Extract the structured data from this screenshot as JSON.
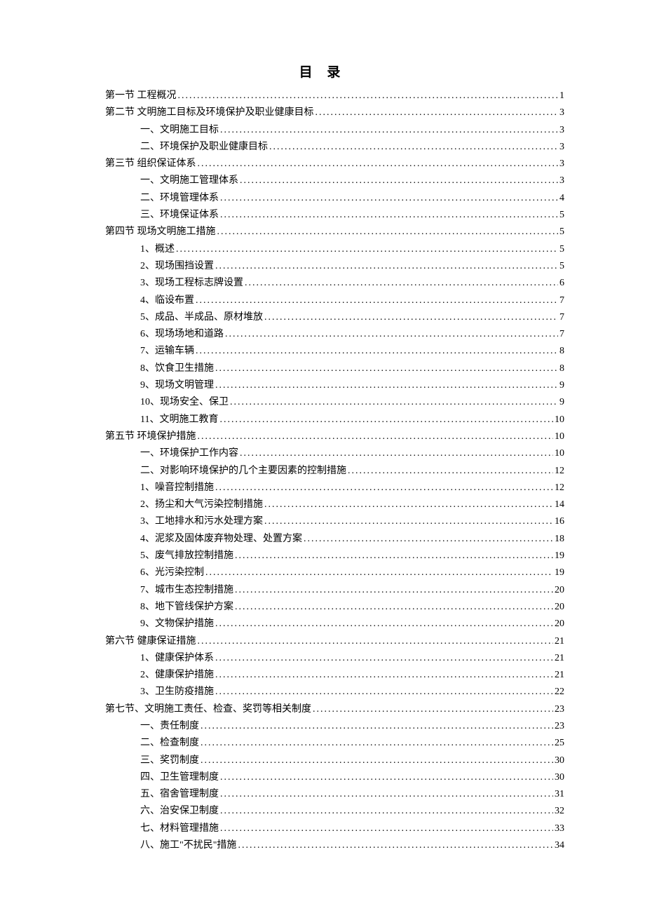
{
  "title": "目 录",
  "entries": [
    {
      "label": "第一节  工程概况",
      "page": "1",
      "level": 0
    },
    {
      "label": "第二节  文明施工目标及环境保护及职业健康目标",
      "page": "3",
      "level": 0
    },
    {
      "label": "一、文明施工目标",
      "page": "3",
      "level": 1
    },
    {
      "label": "二、环境保护及职业健康目标",
      "page": "3",
      "level": 1
    },
    {
      "label": "第三节   组织保证体系",
      "page": "3",
      "level": 0
    },
    {
      "label": "一、文明施工管理体系",
      "page": "3",
      "level": 1
    },
    {
      "label": "二、环境管理体系",
      "page": "4",
      "level": 1
    },
    {
      "label": "三、环境保证体系",
      "page": "5",
      "level": 1
    },
    {
      "label": "第四节   现场文明施工措施",
      "page": "5",
      "level": 0
    },
    {
      "label": "1、概述",
      "page": "5",
      "level": 1
    },
    {
      "label": "2、现场围挡设置",
      "page": "5",
      "level": 1
    },
    {
      "label": "3、现场工程标志牌设置",
      "page": "6",
      "level": 1
    },
    {
      "label": "4、临设布置",
      "page": "7",
      "level": 1
    },
    {
      "label": "5、成品、半成品、原材堆放",
      "page": "7",
      "level": 1
    },
    {
      "label": "6、现场场地和道路",
      "page": "7",
      "level": 1
    },
    {
      "label": "7、运输车辆",
      "page": "8",
      "level": 1
    },
    {
      "label": "8、饮食卫生措施",
      "page": "8",
      "level": 1
    },
    {
      "label": "9、现场文明管理",
      "page": "9",
      "level": 1
    },
    {
      "label": "10、现场安全、保卫",
      "page": "9",
      "level": 1
    },
    {
      "label": "11、文明施工教育",
      "page": "10",
      "level": 1
    },
    {
      "label": "第五节   环境保护措施",
      "page": "10",
      "level": 0
    },
    {
      "label": "一、环境保护工作内容",
      "page": "10",
      "level": 1
    },
    {
      "label": "二、对影响环境保护的几个主要因素的控制措施",
      "page": "12",
      "level": 1
    },
    {
      "label": "1、噪音控制措施",
      "page": "12",
      "level": 1
    },
    {
      "label": "2、扬尘和大气污染控制措施",
      "page": "14",
      "level": 1
    },
    {
      "label": "3、工地排水和污水处理方案",
      "page": "16",
      "level": 1
    },
    {
      "label": "4、泥浆及固体废弃物处理、处置方案",
      "page": "18",
      "level": 1
    },
    {
      "label": "5、废气排放控制措施",
      "page": "19",
      "level": 1
    },
    {
      "label": "6、光污染控制",
      "page": "19",
      "level": 1
    },
    {
      "label": "7、城市生态控制措施",
      "page": "20",
      "level": 1
    },
    {
      "label": "8、地下管线保护方案",
      "page": "20",
      "level": 1
    },
    {
      "label": "9、文物保护措施",
      "page": "20",
      "level": 1
    },
    {
      "label": "第六节   健康保证措施",
      "page": "21",
      "level": 0
    },
    {
      "label": "1、健康保护体系",
      "page": "21",
      "level": 1
    },
    {
      "label": "2、健康保护措施",
      "page": "21",
      "level": 1
    },
    {
      "label": "3、卫生防疫措施",
      "page": "22",
      "level": 1
    },
    {
      "label": "第七节、文明施工责任、检查、奖罚等相关制度",
      "page": "23",
      "level": 0
    },
    {
      "label": "一、责任制度",
      "page": "23",
      "level": 1
    },
    {
      "label": "二、检查制度",
      "page": "25",
      "level": 1
    },
    {
      "label": "三、奖罚制度",
      "page": "30",
      "level": 1
    },
    {
      "label": "四、卫生管理制度",
      "page": "30",
      "level": 1
    },
    {
      "label": "五、宿舍管理制度",
      "page": "31",
      "level": 1
    },
    {
      "label": "六、治安保卫制度",
      "page": "32",
      "level": 1
    },
    {
      "label": "七、材料管理措施",
      "page": "33",
      "level": 1
    },
    {
      "label": "八、施工\"不扰民\"措施",
      "page": "34",
      "level": 1
    }
  ]
}
